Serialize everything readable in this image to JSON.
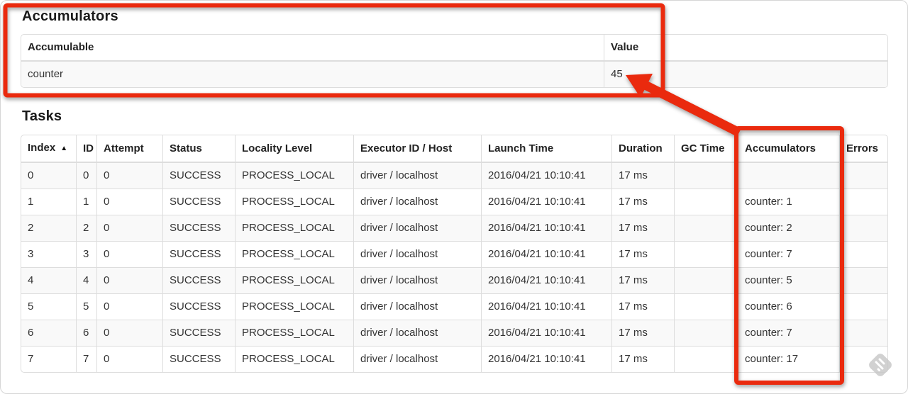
{
  "colors": {
    "annotation_red": "#ea2a0e",
    "table_border": "#dddddd",
    "stripe_background": "#f9f9f9",
    "cell_text": "#333333",
    "heading_text": "#1a1a1a",
    "watermark_gray": "#c9c9c9"
  },
  "accumulators_section": {
    "title": "Accumulators",
    "table": {
      "headers": [
        "Accumulable",
        "Value"
      ],
      "rows": [
        {
          "accumulable": "counter",
          "value": "45"
        }
      ]
    }
  },
  "tasks_section": {
    "title": "Tasks",
    "table": {
      "headers": {
        "index": "Index",
        "sort_indicator": "▲",
        "id": "ID",
        "attempt": "Attempt",
        "status": "Status",
        "locality": "Locality Level",
        "executor": "Executor ID / Host",
        "launch": "Launch Time",
        "duration": "Duration",
        "gc_time": "GC Time",
        "accumulators": "Accumulators",
        "errors": "Errors"
      },
      "rows": [
        {
          "index": "0",
          "id": "0",
          "attempt": "0",
          "status": "SUCCESS",
          "locality": "PROCESS_LOCAL",
          "executor": "driver / localhost",
          "launch": "2016/04/21 10:10:41",
          "duration": "17 ms",
          "gc_time": "",
          "accumulators": "",
          "errors": ""
        },
        {
          "index": "1",
          "id": "1",
          "attempt": "0",
          "status": "SUCCESS",
          "locality": "PROCESS_LOCAL",
          "executor": "driver / localhost",
          "launch": "2016/04/21 10:10:41",
          "duration": "17 ms",
          "gc_time": "",
          "accumulators": "counter: 1",
          "errors": ""
        },
        {
          "index": "2",
          "id": "2",
          "attempt": "0",
          "status": "SUCCESS",
          "locality": "PROCESS_LOCAL",
          "executor": "driver / localhost",
          "launch": "2016/04/21 10:10:41",
          "duration": "17 ms",
          "gc_time": "",
          "accumulators": "counter: 2",
          "errors": ""
        },
        {
          "index": "3",
          "id": "3",
          "attempt": "0",
          "status": "SUCCESS",
          "locality": "PROCESS_LOCAL",
          "executor": "driver / localhost",
          "launch": "2016/04/21 10:10:41",
          "duration": "17 ms",
          "gc_time": "",
          "accumulators": "counter: 7",
          "errors": ""
        },
        {
          "index": "4",
          "id": "4",
          "attempt": "0",
          "status": "SUCCESS",
          "locality": "PROCESS_LOCAL",
          "executor": "driver / localhost",
          "launch": "2016/04/21 10:10:41",
          "duration": "17 ms",
          "gc_time": "",
          "accumulators": "counter: 5",
          "errors": ""
        },
        {
          "index": "5",
          "id": "5",
          "attempt": "0",
          "status": "SUCCESS",
          "locality": "PROCESS_LOCAL",
          "executor": "driver / localhost",
          "launch": "2016/04/21 10:10:41",
          "duration": "17 ms",
          "gc_time": "",
          "accumulators": "counter: 6",
          "errors": ""
        },
        {
          "index": "6",
          "id": "6",
          "attempt": "0",
          "status": "SUCCESS",
          "locality": "PROCESS_LOCAL",
          "executor": "driver / localhost",
          "launch": "2016/04/21 10:10:41",
          "duration": "17 ms",
          "gc_time": "",
          "accumulators": "counter: 7",
          "errors": ""
        },
        {
          "index": "7",
          "id": "7",
          "attempt": "0",
          "status": "SUCCESS",
          "locality": "PROCESS_LOCAL",
          "executor": "driver / localhost",
          "launch": "2016/04/21 10:10:41",
          "duration": "17 ms",
          "gc_time": "",
          "accumulators": "counter: 17",
          "errors": ""
        }
      ]
    }
  }
}
